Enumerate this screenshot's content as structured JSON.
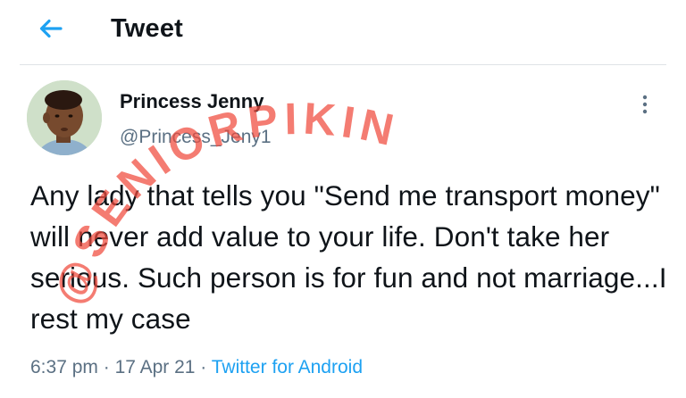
{
  "header": {
    "title": "Tweet",
    "back_icon": "arrow-left-icon"
  },
  "author": {
    "display_name": "Princess Jenny",
    "handle": "@Princess_Jeny1"
  },
  "more_icon": "vertical-ellipsis-icon",
  "tweet": {
    "text": "Any lady that tells you \"Send me transport money\" will never add value to your life. Don't take her serious. Such person is for fun and not marriage...I rest my case"
  },
  "meta": {
    "time": "6:37 pm",
    "sep1": " · ",
    "date": "17 Apr 21",
    "sep2": " · ",
    "source": "Twitter for Android"
  },
  "watermark": {
    "text": "@SENIORPIKIN"
  },
  "colors": {
    "accent": "#1da1f2",
    "secondary_text": "#5b7083",
    "primary_text": "#0f1419",
    "watermark": "#f04a3c"
  }
}
